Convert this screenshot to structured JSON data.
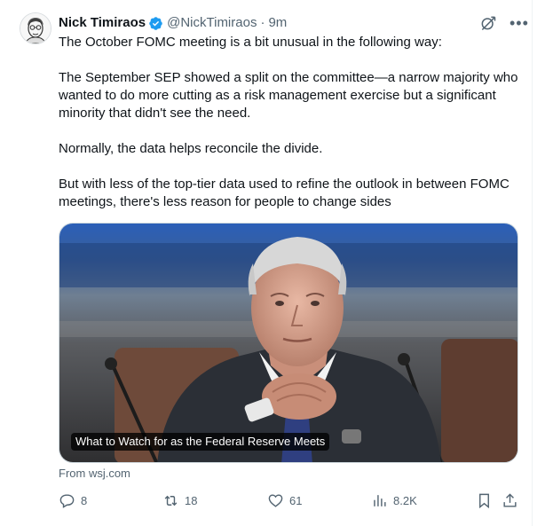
{
  "author": {
    "display_name": "Nick Timiraos",
    "handle": "@NickTimiraos",
    "separator": "·",
    "time": "9m",
    "verified_color": "#1d9bf0"
  },
  "tweet": {
    "paragraphs": [
      "The October FOMC meeting is a bit unusual in the following way:",
      "The September SEP showed a split on the committee—a narrow majority who wanted to do more cutting as a risk management exercise but a significant minority that didn't see the need.",
      "Normally, the data helps reconcile the divide.",
      "But with less of the top-tier data used to refine the outlook in between FOMC meetings, there's less reason for people to change sides"
    ]
  },
  "card": {
    "caption": "What to Watch for as the Federal Reserve Meets",
    "source": "From wsj.com"
  },
  "actions": {
    "replies": "8",
    "reposts": "18",
    "likes": "61",
    "views": "8.2K"
  },
  "icons": {
    "verified": "verified-badge-icon",
    "grok": "grok-icon",
    "more": "more-icon",
    "reply": "reply-icon",
    "repost": "repost-icon",
    "like": "heart-icon",
    "views": "views-icon",
    "bookmark": "bookmark-icon",
    "share": "share-icon"
  },
  "colors": {
    "text": "#0f1419",
    "secondary": "#536471",
    "accent": "#1d9bf0"
  }
}
